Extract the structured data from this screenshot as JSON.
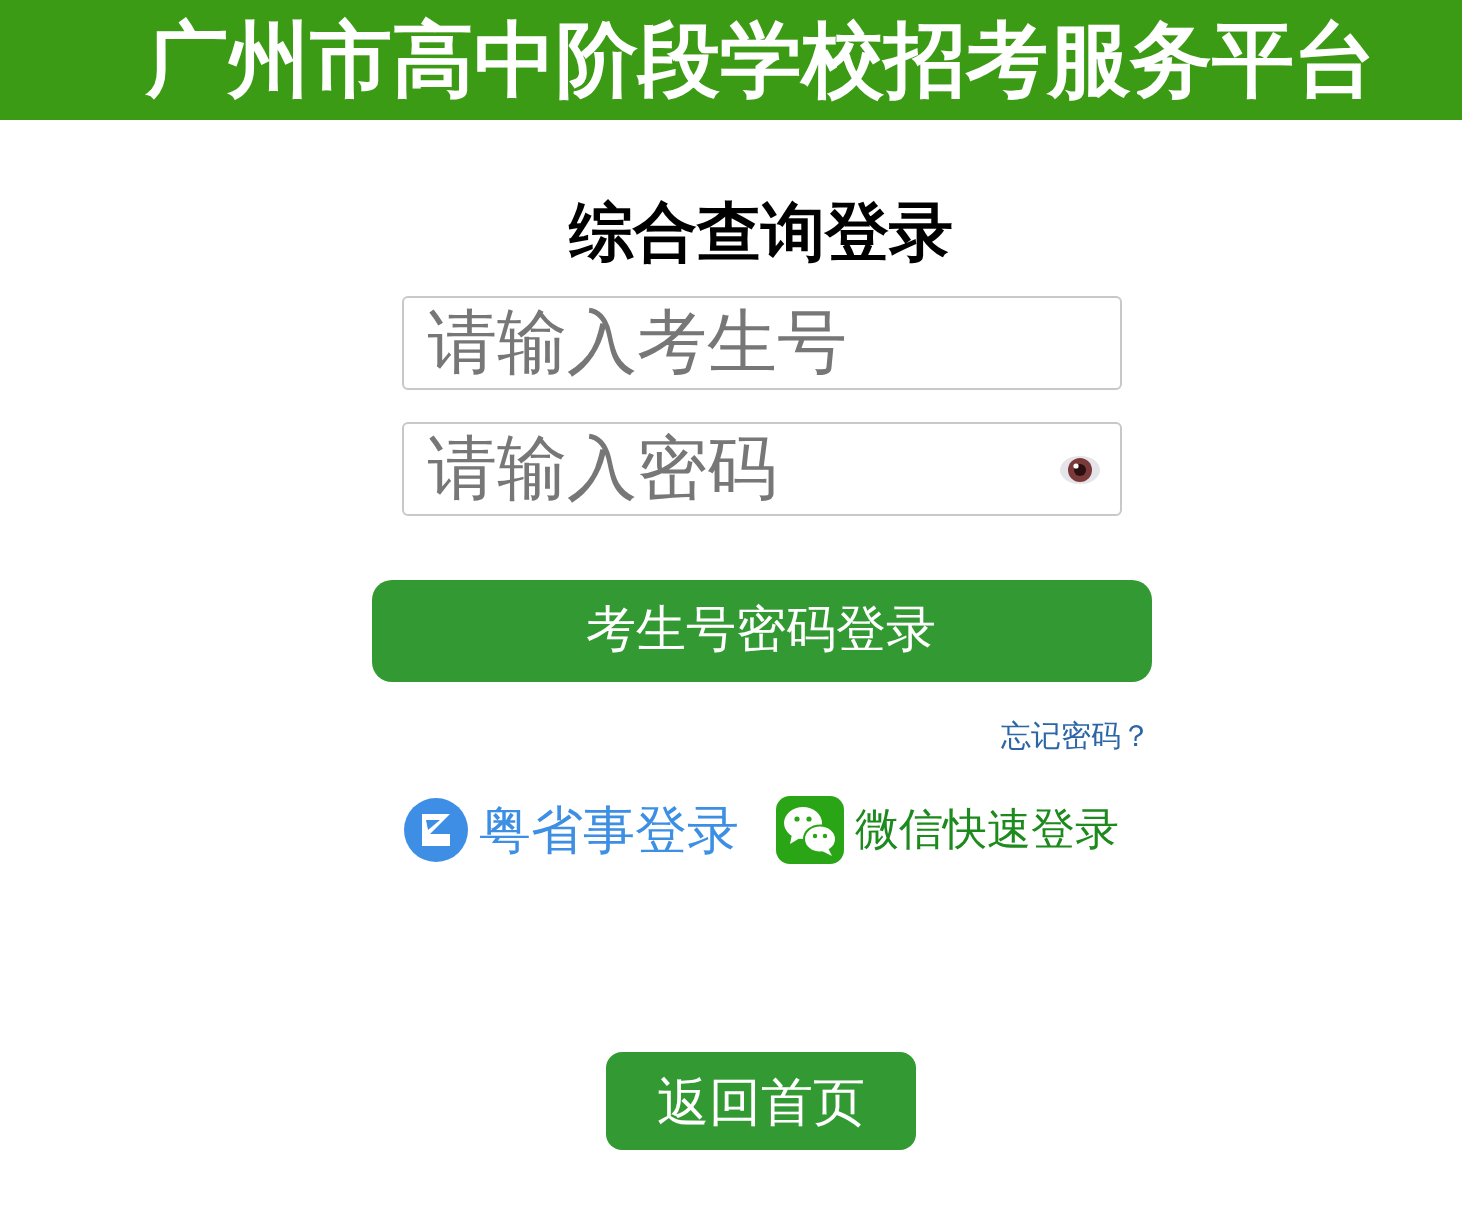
{
  "header": {
    "title": "广州市高中阶段学校招考服务平台"
  },
  "login": {
    "heading": "综合查询登录",
    "fields": [
      {
        "kind": "text",
        "placeholder": "请输入考生号"
      },
      {
        "kind": "password",
        "placeholder": "请输入密码"
      }
    ],
    "submit": "考生号密码登录",
    "forgot_link": "忘记密码？"
  },
  "alt_logins": [
    {
      "kind": "yueshengshi",
      "label": "粤省事登录"
    },
    {
      "kind": "wechat",
      "label": "微信快速登录"
    }
  ],
  "back_button": "返回首页"
}
